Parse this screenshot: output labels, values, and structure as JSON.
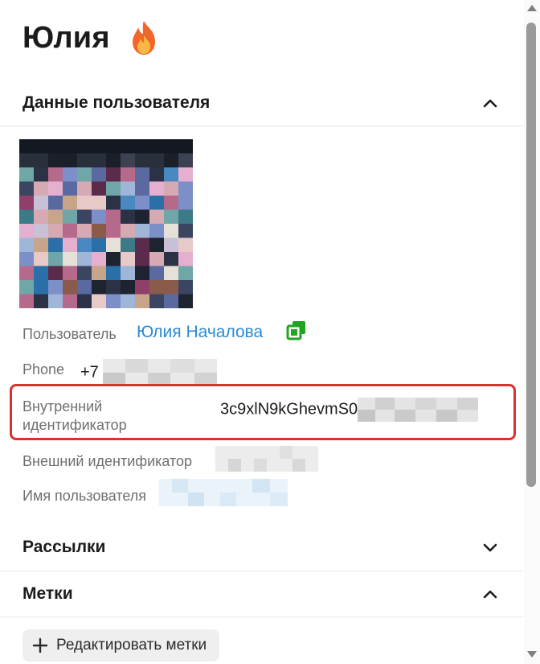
{
  "header": {
    "name": "Юлия",
    "badge_icon": "fire-emoji-icon"
  },
  "sections": {
    "user_data": {
      "title": "Данные пользователя",
      "state": "expanded"
    },
    "mailings": {
      "title": "Рассылки",
      "state": "collapsed"
    },
    "tags": {
      "title": "Метки",
      "state": "expanded"
    }
  },
  "fields": {
    "user": {
      "label": "Пользователь",
      "value": "Юлия Началова"
    },
    "phone": {
      "label": "Phone",
      "value": "+7"
    },
    "internal_id": {
      "label_line1": "Внутренний",
      "label_line2": "идентификатор",
      "value": "3c9xlN9kGhevmS0"
    },
    "external_id": {
      "label": "Внешний идентификатор"
    },
    "username": {
      "label": "Имя пользователя"
    }
  },
  "tags": {
    "edit_label": "Редактировать метки"
  },
  "colors": {
    "link": "#2a8bd3",
    "highlight": "#d8322f",
    "copy_icon": "#1fa51f"
  }
}
